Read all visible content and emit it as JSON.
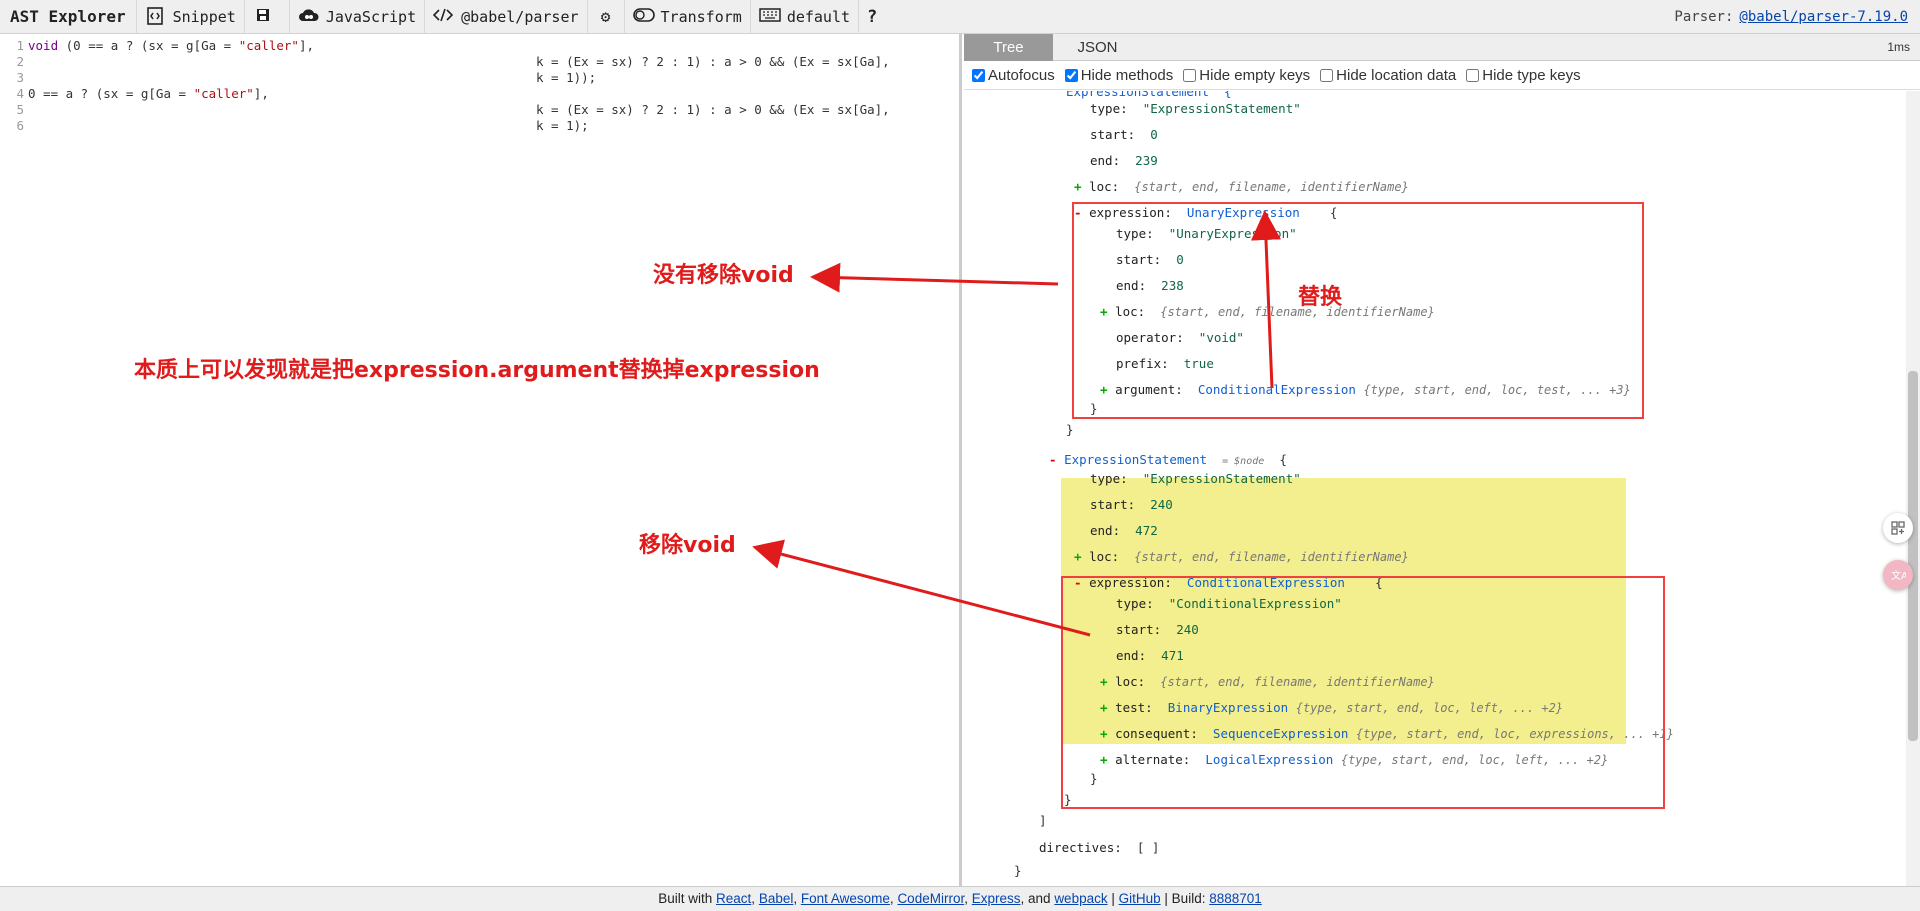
{
  "toolbar": {
    "brand": "AST Explorer",
    "snippet": "Snippet",
    "language": "JavaScript",
    "parser": "@babel/parser",
    "transform": "Transform",
    "keymap": "default",
    "help": "?",
    "parser_label": "Parser:",
    "parser_version": "@babel/parser-7.19.0"
  },
  "editor": {
    "lines": [
      {
        "n": "1",
        "parts": [
          {
            "t": "void",
            "c": "kw"
          },
          {
            "t": " (0 == a ? (sx = g[Ga = ",
            "c": ""
          },
          {
            "t": "\"caller\"",
            "c": "str"
          },
          {
            "t": "],",
            "c": ""
          }
        ]
      },
      {
        "n": "2",
        "parts": [
          {
            "t": "",
            "c": ""
          }
        ]
      },
      {
        "n": "3",
        "parts": [
          {
            "t": "",
            "c": ""
          }
        ]
      },
      {
        "n": "4",
        "parts": [
          {
            "t": "0 == a ? (sx = g[Ga = ",
            "c": ""
          },
          {
            "t": "\"caller\"",
            "c": "str"
          },
          {
            "t": "],",
            "c": ""
          }
        ]
      },
      {
        "n": "5",
        "parts": [
          {
            "t": "",
            "c": ""
          }
        ]
      },
      {
        "n": "6",
        "parts": [
          {
            "t": "",
            "c": ""
          }
        ]
      }
    ],
    "continuations": [
      {
        "row": 1,
        "text": "k = (Ex = sx) ? 2 : 1) : a > 0 && (Ex = sx[Ga],"
      },
      {
        "row": 2,
        "text": "k = 1));"
      },
      {
        "row": 4,
        "text": "k = (Ex = sx) ? 2 : 1) : a > 0 && (Ex = sx[Ga],"
      },
      {
        "row": 5,
        "text": "k = 1);"
      }
    ]
  },
  "tabs": {
    "tree": "Tree",
    "json": "JSON",
    "timing": "1ms"
  },
  "options": [
    {
      "label": "Autofocus",
      "checked": true
    },
    {
      "label": "Hide methods",
      "checked": true
    },
    {
      "label": "Hide empty keys",
      "checked": false
    },
    {
      "label": "Hide location data",
      "checked": false
    },
    {
      "label": "Hide type keys",
      "checked": false
    }
  ],
  "tree": {
    "es1_type": "\"ExpressionStatement\"",
    "es1_start": "0",
    "es1_end": "239",
    "loc_summary": "{start, end, filename, identifierName}",
    "expr1_type_name": "UnaryExpression",
    "expr1_type": "\"UnaryExpression\"",
    "expr1_start": "0",
    "expr1_end": "238",
    "expr1_operator": "\"void\"",
    "expr1_prefix": "true",
    "expr1_argument": "ConditionalExpression",
    "expr1_argument_summary": "{type, start, end, loc, test, ... +3}",
    "es2_name": "ExpressionStatement",
    "es2_node": "= $node",
    "es2_type": "\"ExpressionStatement\"",
    "es2_start": "240",
    "es2_end": "472",
    "expr2_type_name": "ConditionalExpression",
    "expr2_type": "\"ConditionalExpression\"",
    "expr2_start": "240",
    "expr2_end": "471",
    "test_type": "BinaryExpression",
    "test_summary": "{type, start, end, loc, left, ... +2}",
    "consequent_type": "SequenceExpression",
    "consequent_summary": "{type, start, end, loc, expressions, ... +1}",
    "alternate_type": "LogicalExpression",
    "alternate_summary": "{type, start, end, loc, left, ... +2}",
    "keys": {
      "type": "type:",
      "start": "start:",
      "end": "end:",
      "loc": "loc:",
      "expression": "expression:",
      "operator": "operator:",
      "prefix": "prefix:",
      "argument": "argument:",
      "test": "test:",
      "consequent": "consequent:",
      "alternate": "alternate:",
      "directives": "directives:"
    },
    "directives_value": "[ ]"
  },
  "annotations": {
    "no_remove_void": "没有移除void",
    "replace": "替换",
    "essence": "本质上可以发现就是把expression.argument替换掉expression",
    "remove_void": "移除void",
    "color": "#e01b1b"
  },
  "footer": {
    "built_with": "Built with",
    "react": "React",
    "babel": "Babel",
    "fontawesome": "Font Awesome",
    "codemirror": "CodeMirror",
    "express": "Express",
    "and": ", and",
    "webpack": "webpack",
    "github": "GitHub",
    "build_label": "| Build:",
    "build_hash": "8888701"
  }
}
